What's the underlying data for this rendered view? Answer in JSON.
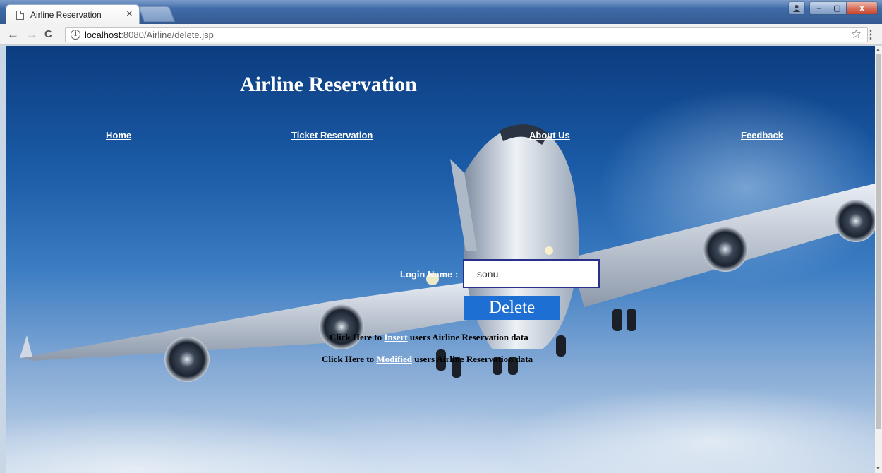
{
  "browser": {
    "tab_title": "Airline Reservation",
    "tab_close": "×",
    "url_host": "localhost",
    "url_path": ":8080/Airline/delete.jsp",
    "icons": [
      "page-icon",
      "back-icon",
      "forward-icon",
      "reload-icon",
      "info-icon",
      "star-icon",
      "menu-icon"
    ],
    "win": {
      "min": "–",
      "max": "▢",
      "close": "x"
    }
  },
  "page": {
    "title": "Airline Reservation",
    "nav": {
      "home": "Home",
      "ticket": "Ticket Reservation",
      "about": "About Us",
      "feedback": "Feedback"
    },
    "form": {
      "login_label": "Login Name :",
      "login_value": "sonu",
      "delete_label": "Delete"
    },
    "links": {
      "line1_pre": "Click Here to ",
      "line1_link": "Insert",
      "line1_post": " users Airline Reservation data",
      "line2_pre": "Click Here to ",
      "line2_link": "Modified",
      "line2_post": " users Airline Reservation data"
    }
  }
}
